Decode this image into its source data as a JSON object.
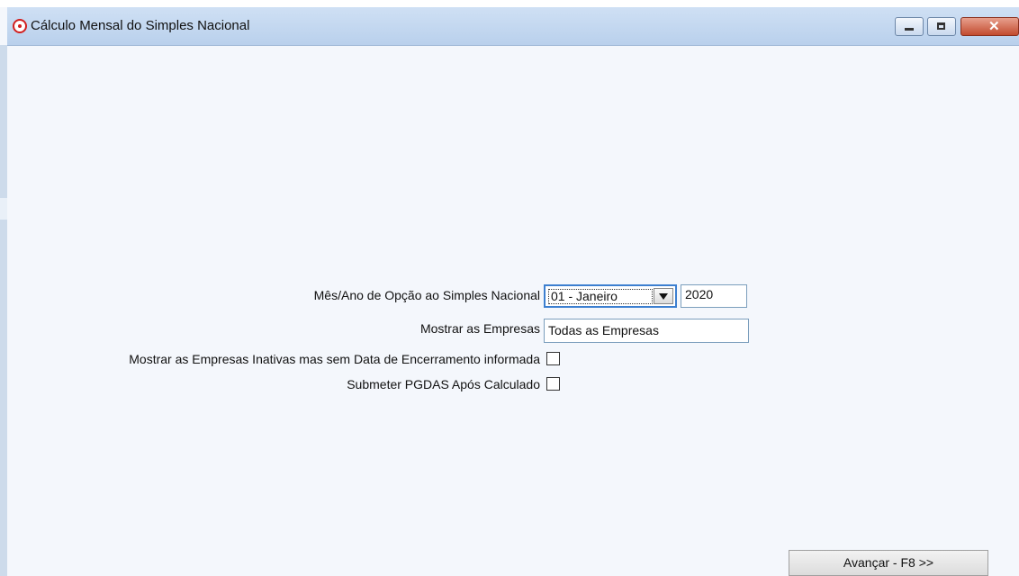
{
  "window": {
    "title": "Cálculo Mensal do Simples Nacional"
  },
  "form": {
    "option_label": "Mês/Ano de Opção ao Simples Nacional",
    "month_value": "01 - Janeiro",
    "year_value": "2020",
    "show_companies_label": "Mostrar as Empresas",
    "show_companies_value": "Todas as Empresas",
    "inactive_label": "Mostrar as Empresas Inativas mas sem Data de Encerramento informada",
    "inactive_checked": false,
    "submit_label": "Submeter PGDAS Após Calculado",
    "submit_checked": false
  },
  "footer": {
    "next_button": "Avançar - F8 >>"
  },
  "colors": {
    "titlebar": "#b9d0ec",
    "client_bg": "#f4f7fc",
    "focus_border": "#3c7fd0",
    "close_button": "#c24b2f"
  },
  "icons": [
    "app-icon",
    "minimize-icon",
    "maximize-icon",
    "close-icon",
    "dropdown-arrow-icon"
  ]
}
